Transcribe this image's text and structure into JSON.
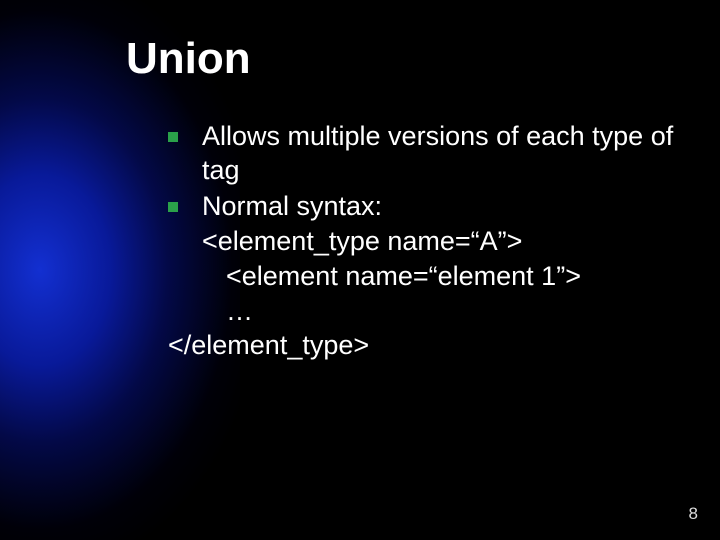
{
  "slide": {
    "title": "Union",
    "bullets": [
      {
        "text": "Allows multiple versions of each type of tag"
      },
      {
        "text": "Normal syntax:",
        "lines": [
          "<element_type name=“A”>",
          "<element name=“element 1”>",
          "…"
        ],
        "closing": "</element_type>"
      }
    ],
    "page_number": "8"
  }
}
